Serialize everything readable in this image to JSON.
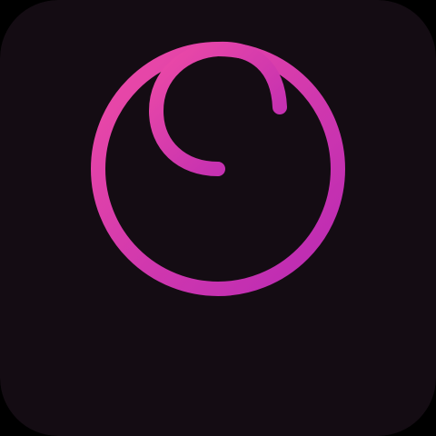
{
  "icon": {
    "name": "app-logo-icon",
    "background_color": "#140c13",
    "gradient_start": "#ee4ba6",
    "gradient_end": "#b929b4"
  }
}
